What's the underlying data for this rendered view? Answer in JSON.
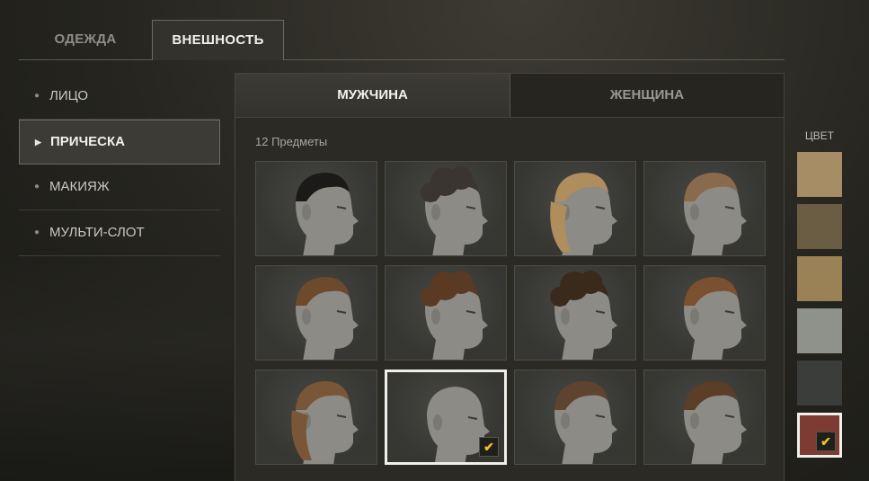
{
  "top_tabs": [
    {
      "label": "ОДЕЖДА",
      "active": false
    },
    {
      "label": "ВНЕШНОСТЬ",
      "active": true
    }
  ],
  "sidebar": {
    "items": [
      {
        "label": "ЛИЦО",
        "active": false
      },
      {
        "label": "ПРИЧЕСКА",
        "active": true
      },
      {
        "label": "МАКИЯЖ",
        "active": false
      },
      {
        "label": "МУЛЬТИ-СЛОТ",
        "active": false
      }
    ]
  },
  "gender_tabs": [
    {
      "label": "МУЖЧИНА",
      "active": true
    },
    {
      "label": "ЖЕНЩИНА",
      "active": false
    }
  ],
  "items_count": "12 Предметы",
  "hairstyles": [
    {
      "name": "short-fade-black",
      "hair_color": "#1c1a18",
      "selected": false
    },
    {
      "name": "curly-top-dark",
      "hair_color": "#3a3530",
      "selected": false
    },
    {
      "name": "long-braid-blond",
      "hair_color": "#b08d5c",
      "selected": false
    },
    {
      "name": "undercut-light",
      "hair_color": "#8a6a4c",
      "selected": false
    },
    {
      "name": "medium-swept-brown",
      "hair_color": "#6e4a2c",
      "selected": false
    },
    {
      "name": "afro-curly-brown",
      "hair_color": "#5a3a22",
      "selected": false
    },
    {
      "name": "short-curly-dark",
      "hair_color": "#3a2a1c",
      "selected": false
    },
    {
      "name": "side-shave-auburn",
      "hair_color": "#7a5030",
      "selected": false
    },
    {
      "name": "wavy-long-brown",
      "hair_color": "#7a5638",
      "selected": false
    },
    {
      "name": "bald",
      "hair_color": "#9a8a80",
      "selected": true
    },
    {
      "name": "tied-back-brown",
      "hair_color": "#5e4430",
      "selected": false
    },
    {
      "name": "short-textured-brown",
      "hair_color": "#5a3e28",
      "selected": false
    }
  ],
  "color_label": "ЦВЕТ",
  "colors": [
    {
      "hex": "#a68d66",
      "selected": false
    },
    {
      "hex": "#6b5d44",
      "selected": false
    },
    {
      "hex": "#9a8256",
      "selected": false
    },
    {
      "hex": "#8e928a",
      "selected": false
    },
    {
      "hex": "#3a3d3a",
      "selected": false
    },
    {
      "hex": "#7d3b33",
      "selected": true
    }
  ],
  "check_icon": "checkmark-icon"
}
